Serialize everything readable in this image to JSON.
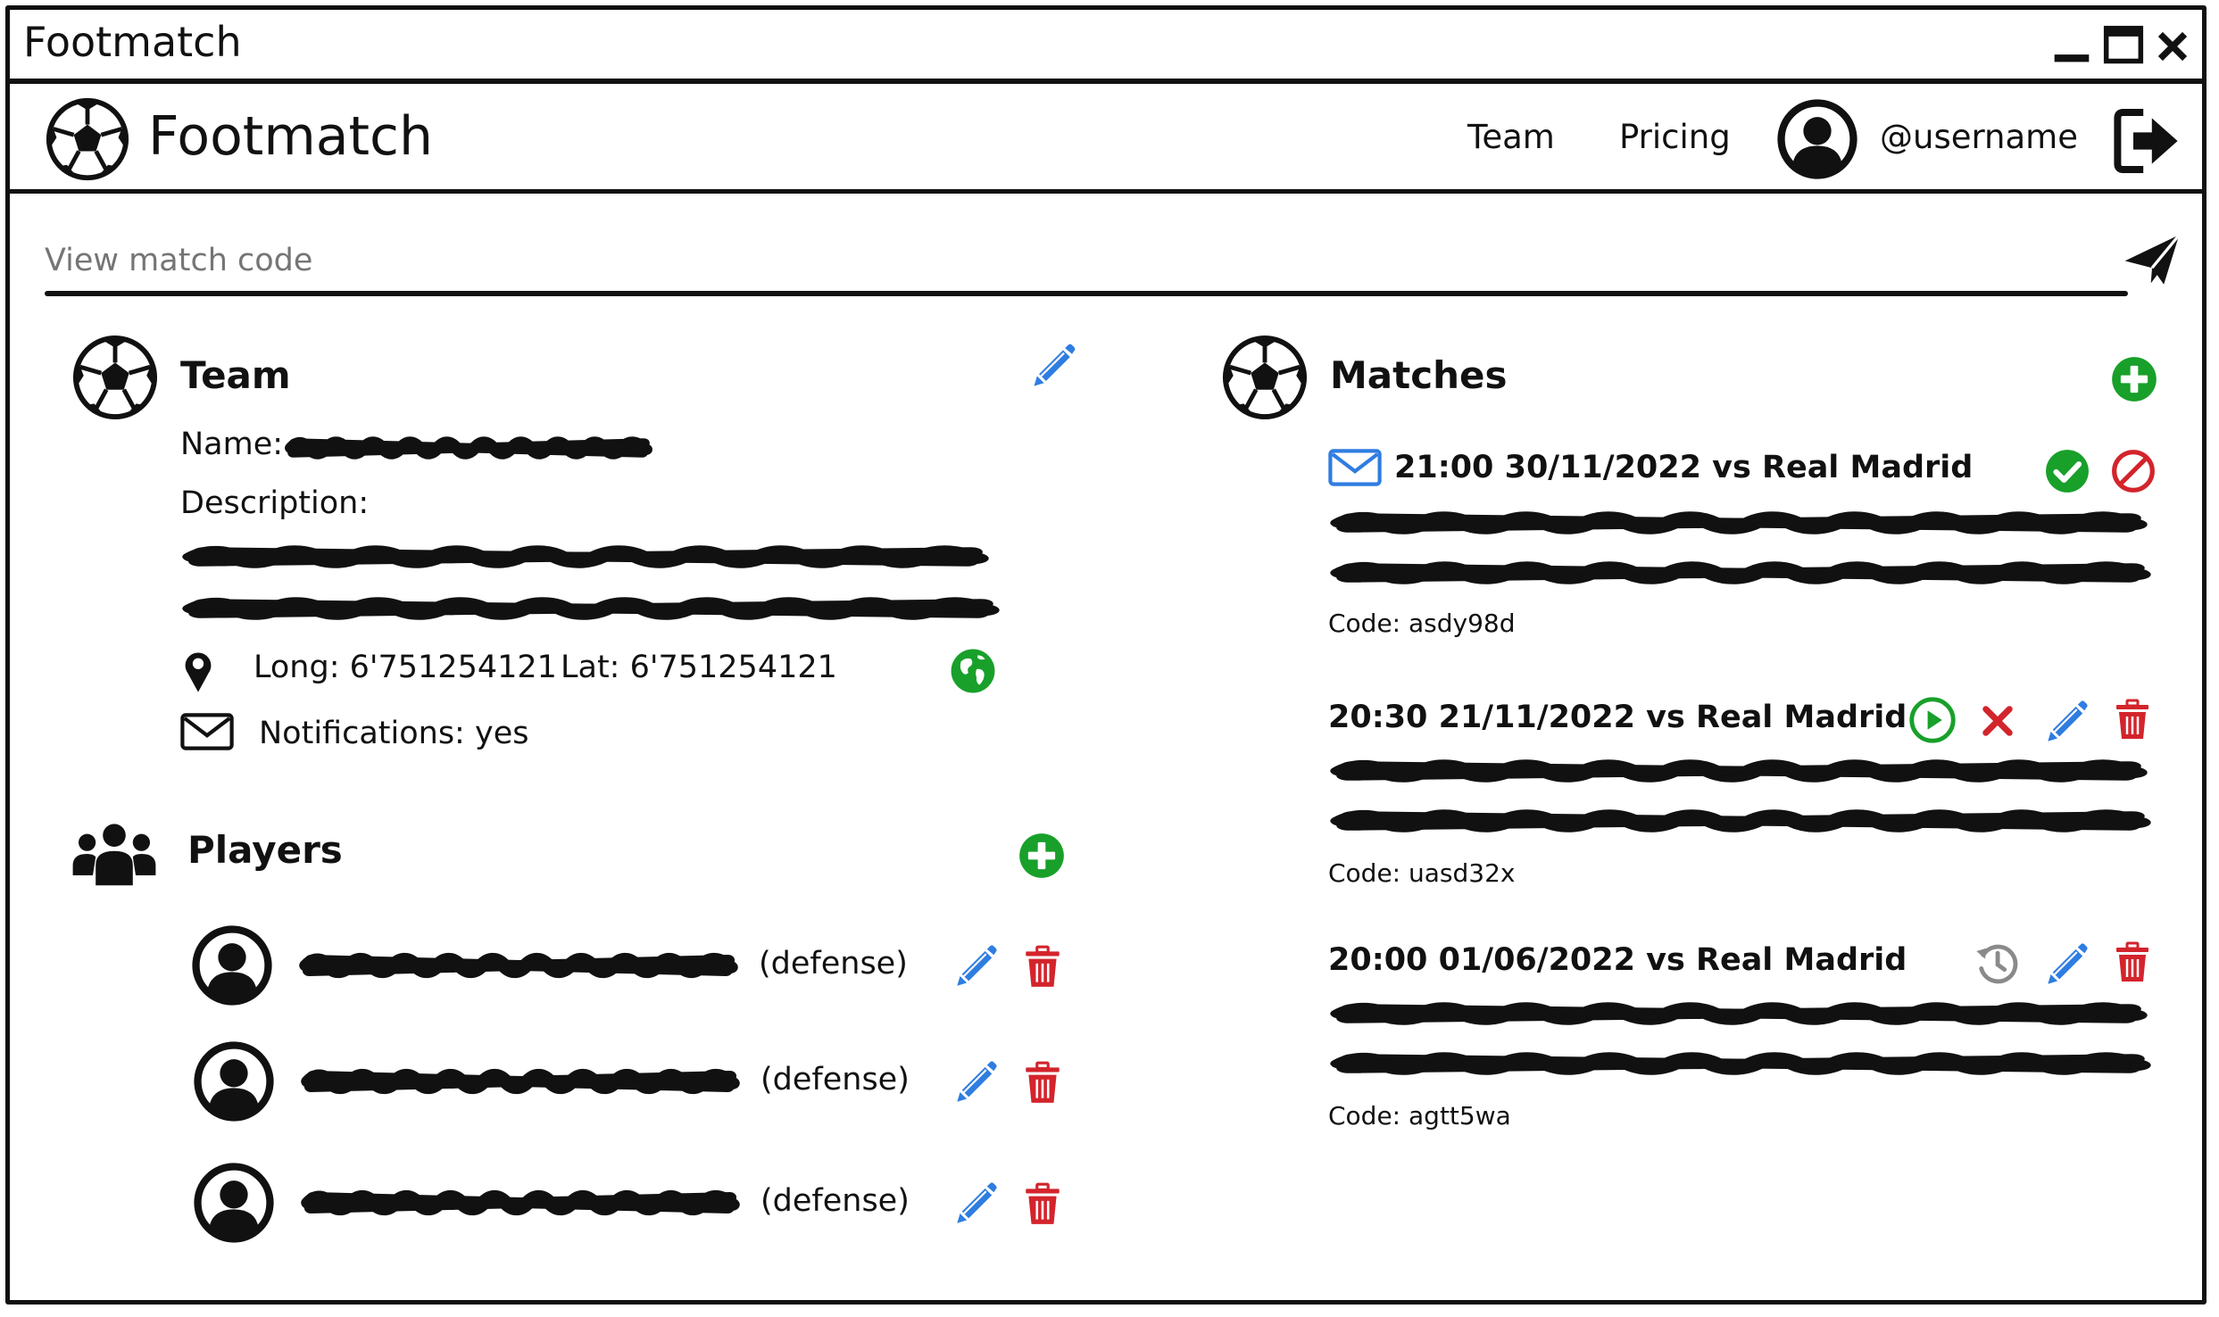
{
  "window": {
    "title": "Footmatch"
  },
  "header": {
    "brand": "Footmatch",
    "nav": [
      {
        "label": "Team"
      },
      {
        "label": "Pricing"
      }
    ],
    "username": "@username"
  },
  "search": {
    "placeholder": "View match code"
  },
  "team": {
    "heading": "Team",
    "name_label": "Name:",
    "description_label": "Description:",
    "longitude": "Long: 6'751254121",
    "latitude": "Lat: 6'751254121",
    "notifications": "Notifications: yes"
  },
  "players": {
    "heading": "Players",
    "items": [
      {
        "position": "(defense)"
      },
      {
        "position": "(defense)"
      },
      {
        "position": "(defense)"
      }
    ]
  },
  "matches": {
    "heading": "Matches",
    "items": [
      {
        "title": "21:00 30/11/2022 vs Real Madrid",
        "code": "Code: asdy98d",
        "status": "invitation"
      },
      {
        "title": "20:30 21/11/2022 vs Real Madrid",
        "code": "Code: uasd32x",
        "status": "scheduled"
      },
      {
        "title": "20:00 01/06/2022 vs Real Madrid",
        "code": "Code: agtt5wa",
        "status": "past"
      }
    ]
  },
  "colors": {
    "green": "#18a02a",
    "red": "#d3242c",
    "blue": "#2f7de1",
    "gray": "#8a8a8a",
    "ink": "#111111"
  },
  "icons": [
    "soccer-ball-icon",
    "user-avatar-icon",
    "logout-icon",
    "send-icon",
    "pencil-icon",
    "location-pin-icon",
    "envelope-icon",
    "globe-icon",
    "users-group-icon",
    "add-circle-icon",
    "trash-icon",
    "check-circle-icon",
    "ban-icon",
    "play-circle-icon",
    "close-x-icon",
    "history-icon"
  ]
}
